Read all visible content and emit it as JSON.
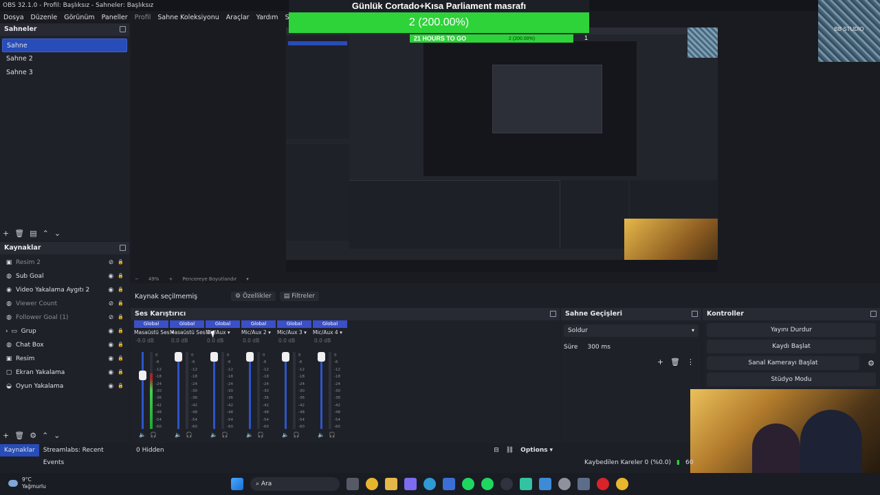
{
  "window": {
    "title": "OBS 32.1.0 - Profil: Başlıksız - Sahneler: Başlıksız"
  },
  "menu": [
    {
      "label": "Dosya",
      "dim": false
    },
    {
      "label": "Düzenle",
      "dim": false
    },
    {
      "label": "Görünüm",
      "dim": false
    },
    {
      "label": "Paneller",
      "dim": false
    },
    {
      "label": "Profil",
      "dim": true
    },
    {
      "label": "Sahne Koleksiyonu",
      "dim": false
    },
    {
      "label": "Araçlar",
      "dim": false
    },
    {
      "label": "Yardım",
      "dim": false
    },
    {
      "label": "Streamlabs",
      "dim": false
    }
  ],
  "scenes": {
    "title": "Sahneler",
    "items": [
      "Sahne",
      "Sahne 2",
      "Sahne 3"
    ],
    "selected": 0
  },
  "sources": {
    "title": "Kaynaklar",
    "items": [
      {
        "label": "Resim 2",
        "icon": "image-icon",
        "visible": false
      },
      {
        "label": "Sub Goal",
        "icon": "globe-icon",
        "visible": true
      },
      {
        "label": "Video Yakalama Aygıtı 2",
        "icon": "camera-icon",
        "visible": true
      },
      {
        "label": "Viewer Count",
        "icon": "globe-icon",
        "visible": false
      },
      {
        "label": "Follower Goal (1)",
        "icon": "globe-icon",
        "visible": false
      },
      {
        "label": "Grup",
        "icon": "folder-icon",
        "visible": true
      },
      {
        "label": "Chat Box",
        "icon": "globe-icon",
        "visible": true
      },
      {
        "label": "Resim",
        "icon": "image-icon",
        "visible": true
      },
      {
        "label": "Ekran Yakalama",
        "icon": "monitor-icon",
        "visible": true
      },
      {
        "label": "Oyun Yakalama",
        "icon": "gamepad-icon",
        "visible": true
      }
    ]
  },
  "bottom_tabs": [
    "Kaynaklar",
    "Streamlabs: Recent Events"
  ],
  "overlay": {
    "title": "Günlük Cortado+Kısa Parliament masrafı",
    "goal_text": "2 (200.00%)",
    "hours_text": "21 HOURS TO GO",
    "sub_pct": "2 (200.00%)",
    "goal_target": "1",
    "logo_text": "BB STUDIO",
    "progress": 1.0
  },
  "preview_zoom": {
    "value": "49%",
    "label": "Pencereye Boyutlandır"
  },
  "properties_row": {
    "no_source": "Kaynak seçilmemiş",
    "properties": "Özellikler",
    "filters": "Filtreler"
  },
  "mixer": {
    "title": "Ses Karıştırıcı",
    "channels": [
      {
        "global": "Global",
        "name": "Masaüstü Ses",
        "db": "-9.0 dB",
        "level": 0.72,
        "fader": 0.72
      },
      {
        "global": "Global",
        "name": "Masaüstü Ses 2",
        "db": "0.0 dB",
        "level": 0.0,
        "fader": 1.0
      },
      {
        "global": "Global",
        "name": "Mic/Aux",
        "db": "0.0 dB",
        "level": 0.0,
        "fader": 1.0
      },
      {
        "global": "Global",
        "name": "Mic/Aux 2",
        "db": "0.0 dB",
        "level": 0.0,
        "fader": 1.0
      },
      {
        "global": "Global",
        "name": "Mic/Aux 3",
        "db": "0.0 dB",
        "level": 0.0,
        "fader": 1.0
      },
      {
        "global": "Global",
        "name": "Mic/Aux 4",
        "db": "0.0 dB",
        "level": 0.0,
        "fader": 1.0
      }
    ],
    "scale": [
      "0",
      "-6",
      "-12",
      "-18",
      "-24",
      "-30",
      "-36",
      "-42",
      "-48",
      "-54",
      "-60"
    ],
    "hidden_count": "0 Hidden",
    "options": "Options"
  },
  "transitions": {
    "title": "Sahne Geçişleri",
    "selected": "Soldur",
    "duration_label": "Süre",
    "duration_value": "300 ms"
  },
  "controls": {
    "title": "Kontroller",
    "buttons": [
      "Yayını Durdur",
      "Kaydı Başlat",
      "Sanal Kamerayı Başlat",
      "Stüdyo Modu"
    ]
  },
  "status": {
    "dropped": "Kaybedilen Kareler 0 (%0.0)",
    "fps_partial": "60"
  },
  "taskbar": {
    "temperature": "9°C",
    "weather": "Yağmurlu",
    "search": "Ara"
  },
  "colors": {
    "accent": "#284cb8",
    "goal_green": "#2ed33a",
    "fader_blue": "#2d55c9"
  }
}
